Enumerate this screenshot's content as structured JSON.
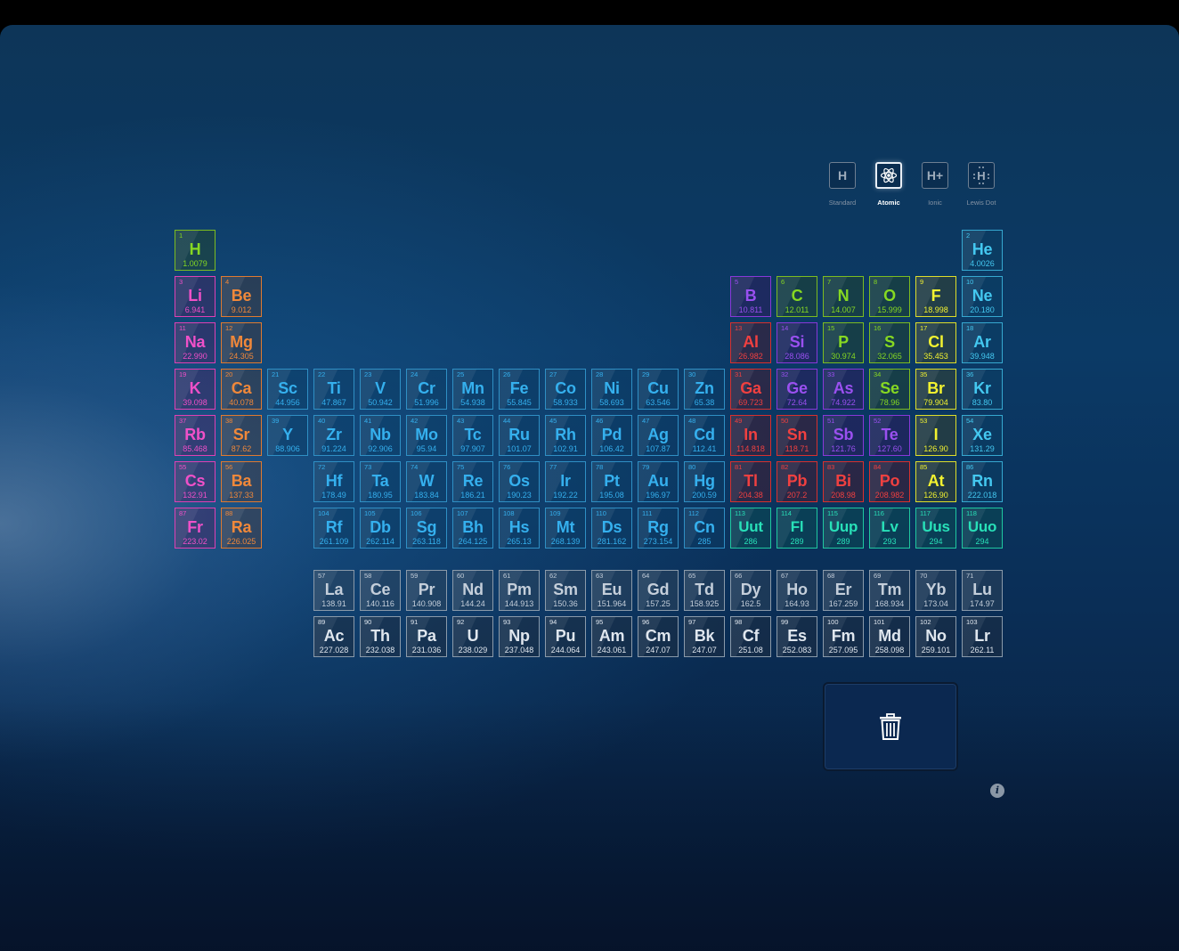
{
  "modes": [
    {
      "id": "standard",
      "label": "Standard",
      "icon": "H",
      "active": false
    },
    {
      "id": "atomic",
      "label": "Atomic",
      "icon": "atom",
      "active": true
    },
    {
      "id": "ionic",
      "label": "Ionic",
      "icon": "H+",
      "active": false
    },
    {
      "id": "lewis",
      "label": "Lewis Dot",
      "icon": "H",
      "active": false
    }
  ],
  "legend_colors": {
    "alkali": "#f050c8",
    "alkaline": "#f0883a",
    "trans": "#35b0ee",
    "post": "#f04040",
    "metalloid": "#9a50f0",
    "nonmetal": "#86d822",
    "halogen": "#f2f230",
    "noble": "#44c8f0",
    "unknown": "#28e0b8",
    "lanth": "#c4ceda",
    "actin": "#dfe6ee"
  },
  "elements": [
    {
      "n": "1",
      "s": "H",
      "m": "1.0079",
      "g": 1,
      "p": 1,
      "c": "nonmetal"
    },
    {
      "n": "2",
      "s": "He",
      "m": "4.0026",
      "g": 18,
      "p": 1,
      "c": "noble"
    },
    {
      "n": "3",
      "s": "Li",
      "m": "6.941",
      "g": 1,
      "p": 2,
      "c": "alkali"
    },
    {
      "n": "4",
      "s": "Be",
      "m": "9.012",
      "g": 2,
      "p": 2,
      "c": "alkaline"
    },
    {
      "n": "5",
      "s": "B",
      "m": "10.811",
      "g": 13,
      "p": 2,
      "c": "metalloid"
    },
    {
      "n": "6",
      "s": "C",
      "m": "12.011",
      "g": 14,
      "p": 2,
      "c": "nonmetal"
    },
    {
      "n": "7",
      "s": "N",
      "m": "14.007",
      "g": 15,
      "p": 2,
      "c": "nonmetal"
    },
    {
      "n": "8",
      "s": "O",
      "m": "15.999",
      "g": 16,
      "p": 2,
      "c": "nonmetal"
    },
    {
      "n": "9",
      "s": "F",
      "m": "18.998",
      "g": 17,
      "p": 2,
      "c": "halogen"
    },
    {
      "n": "10",
      "s": "Ne",
      "m": "20.180",
      "g": 18,
      "p": 2,
      "c": "noble"
    },
    {
      "n": "11",
      "s": "Na",
      "m": "22.990",
      "g": 1,
      "p": 3,
      "c": "alkali"
    },
    {
      "n": "12",
      "s": "Mg",
      "m": "24.305",
      "g": 2,
      "p": 3,
      "c": "alkaline"
    },
    {
      "n": "13",
      "s": "Al",
      "m": "26.982",
      "g": 13,
      "p": 3,
      "c": "post"
    },
    {
      "n": "14",
      "s": "Si",
      "m": "28.086",
      "g": 14,
      "p": 3,
      "c": "metalloid"
    },
    {
      "n": "15",
      "s": "P",
      "m": "30.974",
      "g": 15,
      "p": 3,
      "c": "nonmetal"
    },
    {
      "n": "16",
      "s": "S",
      "m": "32.065",
      "g": 16,
      "p": 3,
      "c": "nonmetal"
    },
    {
      "n": "17",
      "s": "Cl",
      "m": "35.453",
      "g": 17,
      "p": 3,
      "c": "halogen"
    },
    {
      "n": "18",
      "s": "Ar",
      "m": "39.948",
      "g": 18,
      "p": 3,
      "c": "noble"
    },
    {
      "n": "19",
      "s": "K",
      "m": "39.098",
      "g": 1,
      "p": 4,
      "c": "alkali"
    },
    {
      "n": "20",
      "s": "Ca",
      "m": "40.078",
      "g": 2,
      "p": 4,
      "c": "alkaline"
    },
    {
      "n": "21",
      "s": "Sc",
      "m": "44.956",
      "g": 3,
      "p": 4,
      "c": "trans"
    },
    {
      "n": "22",
      "s": "Ti",
      "m": "47.867",
      "g": 4,
      "p": 4,
      "c": "trans"
    },
    {
      "n": "23",
      "s": "V",
      "m": "50.942",
      "g": 5,
      "p": 4,
      "c": "trans"
    },
    {
      "n": "24",
      "s": "Cr",
      "m": "51.996",
      "g": 6,
      "p": 4,
      "c": "trans"
    },
    {
      "n": "25",
      "s": "Mn",
      "m": "54.938",
      "g": 7,
      "p": 4,
      "c": "trans"
    },
    {
      "n": "26",
      "s": "Fe",
      "m": "55.845",
      "g": 8,
      "p": 4,
      "c": "trans"
    },
    {
      "n": "27",
      "s": "Co",
      "m": "58.933",
      "g": 9,
      "p": 4,
      "c": "trans"
    },
    {
      "n": "28",
      "s": "Ni",
      "m": "58.693",
      "g": 10,
      "p": 4,
      "c": "trans"
    },
    {
      "n": "29",
      "s": "Cu",
      "m": "63.546",
      "g": 11,
      "p": 4,
      "c": "trans"
    },
    {
      "n": "30",
      "s": "Zn",
      "m": "65.38",
      "g": 12,
      "p": 4,
      "c": "trans"
    },
    {
      "n": "31",
      "s": "Ga",
      "m": "69.723",
      "g": 13,
      "p": 4,
      "c": "post"
    },
    {
      "n": "32",
      "s": "Ge",
      "m": "72.64",
      "g": 14,
      "p": 4,
      "c": "metalloid"
    },
    {
      "n": "33",
      "s": "As",
      "m": "74.922",
      "g": 15,
      "p": 4,
      "c": "metalloid"
    },
    {
      "n": "34",
      "s": "Se",
      "m": "78.96",
      "g": 16,
      "p": 4,
      "c": "nonmetal"
    },
    {
      "n": "35",
      "s": "Br",
      "m": "79.904",
      "g": 17,
      "p": 4,
      "c": "halogen"
    },
    {
      "n": "36",
      "s": "Kr",
      "m": "83.80",
      "g": 18,
      "p": 4,
      "c": "noble"
    },
    {
      "n": "37",
      "s": "Rb",
      "m": "85.468",
      "g": 1,
      "p": 5,
      "c": "alkali"
    },
    {
      "n": "38",
      "s": "Sr",
      "m": "87.62",
      "g": 2,
      "p": 5,
      "c": "alkaline"
    },
    {
      "n": "39",
      "s": "Y",
      "m": "88.906",
      "g": 3,
      "p": 5,
      "c": "trans"
    },
    {
      "n": "40",
      "s": "Zr",
      "m": "91.224",
      "g": 4,
      "p": 5,
      "c": "trans"
    },
    {
      "n": "41",
      "s": "Nb",
      "m": "92.906",
      "g": 5,
      "p": 5,
      "c": "trans"
    },
    {
      "n": "42",
      "s": "Mo",
      "m": "95.94",
      "g": 6,
      "p": 5,
      "c": "trans"
    },
    {
      "n": "43",
      "s": "Tc",
      "m": "97.907",
      "g": 7,
      "p": 5,
      "c": "trans"
    },
    {
      "n": "44",
      "s": "Ru",
      "m": "101.07",
      "g": 8,
      "p": 5,
      "c": "trans"
    },
    {
      "n": "45",
      "s": "Rh",
      "m": "102.91",
      "g": 9,
      "p": 5,
      "c": "trans"
    },
    {
      "n": "46",
      "s": "Pd",
      "m": "106.42",
      "g": 10,
      "p": 5,
      "c": "trans"
    },
    {
      "n": "47",
      "s": "Ag",
      "m": "107.87",
      "g": 11,
      "p": 5,
      "c": "trans"
    },
    {
      "n": "48",
      "s": "Cd",
      "m": "112.41",
      "g": 12,
      "p": 5,
      "c": "trans"
    },
    {
      "n": "49",
      "s": "In",
      "m": "114.818",
      "g": 13,
      "p": 5,
      "c": "post"
    },
    {
      "n": "50",
      "s": "Sn",
      "m": "118.71",
      "g": 14,
      "p": 5,
      "c": "post"
    },
    {
      "n": "51",
      "s": "Sb",
      "m": "121.76",
      "g": 15,
      "p": 5,
      "c": "metalloid"
    },
    {
      "n": "52",
      "s": "Te",
      "m": "127.60",
      "g": 16,
      "p": 5,
      "c": "metalloid"
    },
    {
      "n": "53",
      "s": "I",
      "m": "126.90",
      "g": 17,
      "p": 5,
      "c": "halogen"
    },
    {
      "n": "54",
      "s": "Xe",
      "m": "131.29",
      "g": 18,
      "p": 5,
      "c": "noble"
    },
    {
      "n": "55",
      "s": "Cs",
      "m": "132.91",
      "g": 1,
      "p": 6,
      "c": "alkali"
    },
    {
      "n": "56",
      "s": "Ba",
      "m": "137.33",
      "g": 2,
      "p": 6,
      "c": "alkaline"
    },
    {
      "n": "72",
      "s": "Hf",
      "m": "178.49",
      "g": 4,
      "p": 6,
      "c": "trans"
    },
    {
      "n": "73",
      "s": "Ta",
      "m": "180.95",
      "g": 5,
      "p": 6,
      "c": "trans"
    },
    {
      "n": "74",
      "s": "W",
      "m": "183.84",
      "g": 6,
      "p": 6,
      "c": "trans"
    },
    {
      "n": "75",
      "s": "Re",
      "m": "186.21",
      "g": 7,
      "p": 6,
      "c": "trans"
    },
    {
      "n": "76",
      "s": "Os",
      "m": "190.23",
      "g": 8,
      "p": 6,
      "c": "trans"
    },
    {
      "n": "77",
      "s": "Ir",
      "m": "192.22",
      "g": 9,
      "p": 6,
      "c": "trans"
    },
    {
      "n": "78",
      "s": "Pt",
      "m": "195.08",
      "g": 10,
      "p": 6,
      "c": "trans"
    },
    {
      "n": "79",
      "s": "Au",
      "m": "196.97",
      "g": 11,
      "p": 6,
      "c": "trans"
    },
    {
      "n": "80",
      "s": "Hg",
      "m": "200.59",
      "g": 12,
      "p": 6,
      "c": "trans"
    },
    {
      "n": "81",
      "s": "Tl",
      "m": "204.38",
      "g": 13,
      "p": 6,
      "c": "post"
    },
    {
      "n": "82",
      "s": "Pb",
      "m": "207.2",
      "g": 14,
      "p": 6,
      "c": "post"
    },
    {
      "n": "83",
      "s": "Bi",
      "m": "208.98",
      "g": 15,
      "p": 6,
      "c": "post"
    },
    {
      "n": "84",
      "s": "Po",
      "m": "208.982",
      "g": 16,
      "p": 6,
      "c": "post"
    },
    {
      "n": "85",
      "s": "At",
      "m": "126.90",
      "g": 17,
      "p": 6,
      "c": "halogen"
    },
    {
      "n": "86",
      "s": "Rn",
      "m": "222.018",
      "g": 18,
      "p": 6,
      "c": "noble"
    },
    {
      "n": "87",
      "s": "Fr",
      "m": "223.02",
      "g": 1,
      "p": 7,
      "c": "alkali"
    },
    {
      "n": "88",
      "s": "Ra",
      "m": "226.025",
      "g": 2,
      "p": 7,
      "c": "alkaline"
    },
    {
      "n": "104",
      "s": "Rf",
      "m": "261.109",
      "g": 4,
      "p": 7,
      "c": "trans"
    },
    {
      "n": "105",
      "s": "Db",
      "m": "262.114",
      "g": 5,
      "p": 7,
      "c": "trans"
    },
    {
      "n": "106",
      "s": "Sg",
      "m": "263.118",
      "g": 6,
      "p": 7,
      "c": "trans"
    },
    {
      "n": "107",
      "s": "Bh",
      "m": "264.125",
      "g": 7,
      "p": 7,
      "c": "trans"
    },
    {
      "n": "108",
      "s": "Hs",
      "m": "265.13",
      "g": 8,
      "p": 7,
      "c": "trans"
    },
    {
      "n": "109",
      "s": "Mt",
      "m": "268.139",
      "g": 9,
      "p": 7,
      "c": "trans"
    },
    {
      "n": "110",
      "s": "Ds",
      "m": "281.162",
      "g": 10,
      "p": 7,
      "c": "trans"
    },
    {
      "n": "111",
      "s": "Rg",
      "m": "273.154",
      "g": 11,
      "p": 7,
      "c": "trans"
    },
    {
      "n": "112",
      "s": "Cn",
      "m": "285",
      "g": 12,
      "p": 7,
      "c": "trans"
    },
    {
      "n": "113",
      "s": "Uut",
      "m": "286",
      "g": 13,
      "p": 7,
      "c": "unknown"
    },
    {
      "n": "114",
      "s": "Fl",
      "m": "289",
      "g": 14,
      "p": 7,
      "c": "unknown"
    },
    {
      "n": "115",
      "s": "Uup",
      "m": "289",
      "g": 15,
      "p": 7,
      "c": "unknown"
    },
    {
      "n": "116",
      "s": "Lv",
      "m": "293",
      "g": 16,
      "p": 7,
      "c": "unknown"
    },
    {
      "n": "117",
      "s": "Uus",
      "m": "294",
      "g": 17,
      "p": 7,
      "c": "unknown"
    },
    {
      "n": "118",
      "s": "Uuo",
      "m": "294",
      "g": 18,
      "p": 7,
      "c": "unknown"
    },
    {
      "n": "57",
      "s": "La",
      "m": "138.91",
      "g": 4,
      "p": 9,
      "c": "lanth"
    },
    {
      "n": "58",
      "s": "Ce",
      "m": "140.116",
      "g": 5,
      "p": 9,
      "c": "lanth"
    },
    {
      "n": "59",
      "s": "Pr",
      "m": "140.908",
      "g": 6,
      "p": 9,
      "c": "lanth"
    },
    {
      "n": "60",
      "s": "Nd",
      "m": "144.24",
      "g": 7,
      "p": 9,
      "c": "lanth"
    },
    {
      "n": "61",
      "s": "Pm",
      "m": "144.913",
      "g": 8,
      "p": 9,
      "c": "lanth"
    },
    {
      "n": "62",
      "s": "Sm",
      "m": "150.36",
      "g": 9,
      "p": 9,
      "c": "lanth"
    },
    {
      "n": "63",
      "s": "Eu",
      "m": "151.964",
      "g": 10,
      "p": 9,
      "c": "lanth"
    },
    {
      "n": "64",
      "s": "Gd",
      "m": "157.25",
      "g": 11,
      "p": 9,
      "c": "lanth"
    },
    {
      "n": "65",
      "s": "Td",
      "m": "158.925",
      "g": 12,
      "p": 9,
      "c": "lanth"
    },
    {
      "n": "66",
      "s": "Dy",
      "m": "162.5",
      "g": 13,
      "p": 9,
      "c": "lanth"
    },
    {
      "n": "67",
      "s": "Ho",
      "m": "164.93",
      "g": 14,
      "p": 9,
      "c": "lanth"
    },
    {
      "n": "68",
      "s": "Er",
      "m": "167.259",
      "g": 15,
      "p": 9,
      "c": "lanth"
    },
    {
      "n": "69",
      "s": "Tm",
      "m": "168.934",
      "g": 16,
      "p": 9,
      "c": "lanth"
    },
    {
      "n": "70",
      "s": "Yb",
      "m": "173.04",
      "g": 17,
      "p": 9,
      "c": "lanth"
    },
    {
      "n": "71",
      "s": "Lu",
      "m": "174.97",
      "g": 18,
      "p": 9,
      "c": "lanth"
    },
    {
      "n": "89",
      "s": "Ac",
      "m": "227.028",
      "g": 4,
      "p": 10,
      "c": "actin"
    },
    {
      "n": "90",
      "s": "Th",
      "m": "232.038",
      "g": 5,
      "p": 10,
      "c": "actin"
    },
    {
      "n": "91",
      "s": "Pa",
      "m": "231.036",
      "g": 6,
      "p": 10,
      "c": "actin"
    },
    {
      "n": "92",
      "s": "U",
      "m": "238.029",
      "g": 7,
      "p": 10,
      "c": "actin"
    },
    {
      "n": "93",
      "s": "Np",
      "m": "237.048",
      "g": 8,
      "p": 10,
      "c": "actin"
    },
    {
      "n": "94",
      "s": "Pu",
      "m": "244.064",
      "g": 9,
      "p": 10,
      "c": "actin"
    },
    {
      "n": "95",
      "s": "Am",
      "m": "243.061",
      "g": 10,
      "p": 10,
      "c": "actin"
    },
    {
      "n": "96",
      "s": "Cm",
      "m": "247.07",
      "g": 11,
      "p": 10,
      "c": "actin"
    },
    {
      "n": "97",
      "s": "Bk",
      "m": "247.07",
      "g": 12,
      "p": 10,
      "c": "actin"
    },
    {
      "n": "98",
      "s": "Cf",
      "m": "251.08",
      "g": 13,
      "p": 10,
      "c": "actin"
    },
    {
      "n": "99",
      "s": "Es",
      "m": "252.083",
      "g": 14,
      "p": 10,
      "c": "actin"
    },
    {
      "n": "100",
      "s": "Fm",
      "m": "257.095",
      "g": 15,
      "p": 10,
      "c": "actin"
    },
    {
      "n": "101",
      "s": "Md",
      "m": "258.098",
      "g": 16,
      "p": 10,
      "c": "actin"
    },
    {
      "n": "102",
      "s": "No",
      "m": "259.101",
      "g": 17,
      "p": 10,
      "c": "actin"
    },
    {
      "n": "103",
      "s": "Lr",
      "m": "262.11",
      "g": 18,
      "p": 10,
      "c": "actin"
    }
  ],
  "trash_icon": "trash-icon",
  "info_icon": "info-icon",
  "info_glyph": "i"
}
